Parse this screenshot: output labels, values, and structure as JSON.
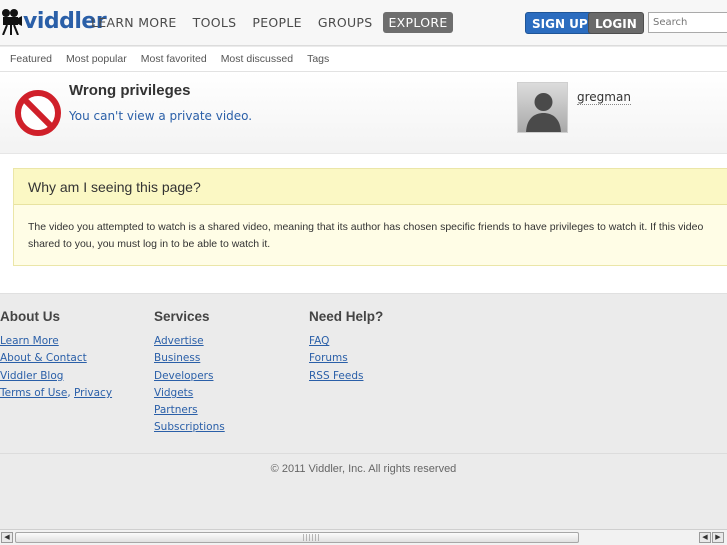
{
  "header": {
    "logo_text": "viddler",
    "nav": [
      "LEARN MORE",
      "TOOLS",
      "PEOPLE",
      "GROUPS",
      "EXPLORE"
    ],
    "active_nav": "EXPLORE",
    "signup_label": "SIGN UP",
    "login_label": "LOGIN",
    "search_placeholder": "Search"
  },
  "subnav": [
    "Featured",
    "Most popular",
    "Most favorited",
    "Most discussed",
    "Tags"
  ],
  "error": {
    "title": "Wrong privileges",
    "message": "You can't view a private video.",
    "username": "gregman"
  },
  "why": {
    "heading": "Why am I seeing this page?",
    "line1": "The video you attempted to watch is a shared video, meaning that its author has chosen specific friends to have privileges to watch it. If this video",
    "line2": "shared to you, you must log in to be able to watch it."
  },
  "footer": {
    "about": {
      "heading": "About Us",
      "links": [
        "Learn More",
        "About & Contact",
        "Viddler Blog"
      ],
      "terms": "Terms of Use",
      "separator": ", ",
      "privacy": "Privacy"
    },
    "services": {
      "heading": "Services",
      "links": [
        "Advertise",
        "Business",
        "Developers",
        "Vidgets",
        "Partners",
        "Subscriptions"
      ]
    },
    "help": {
      "heading": "Need Help?",
      "links": [
        "FAQ",
        "Forums",
        "RSS Feeds"
      ]
    },
    "copyright": "© 2011 Viddler, Inc. All rights reserved"
  },
  "colors": {
    "brand_blue": "#2a5fa8",
    "signup_blue": "#2b6cbf",
    "stop_red": "#d0202a"
  }
}
